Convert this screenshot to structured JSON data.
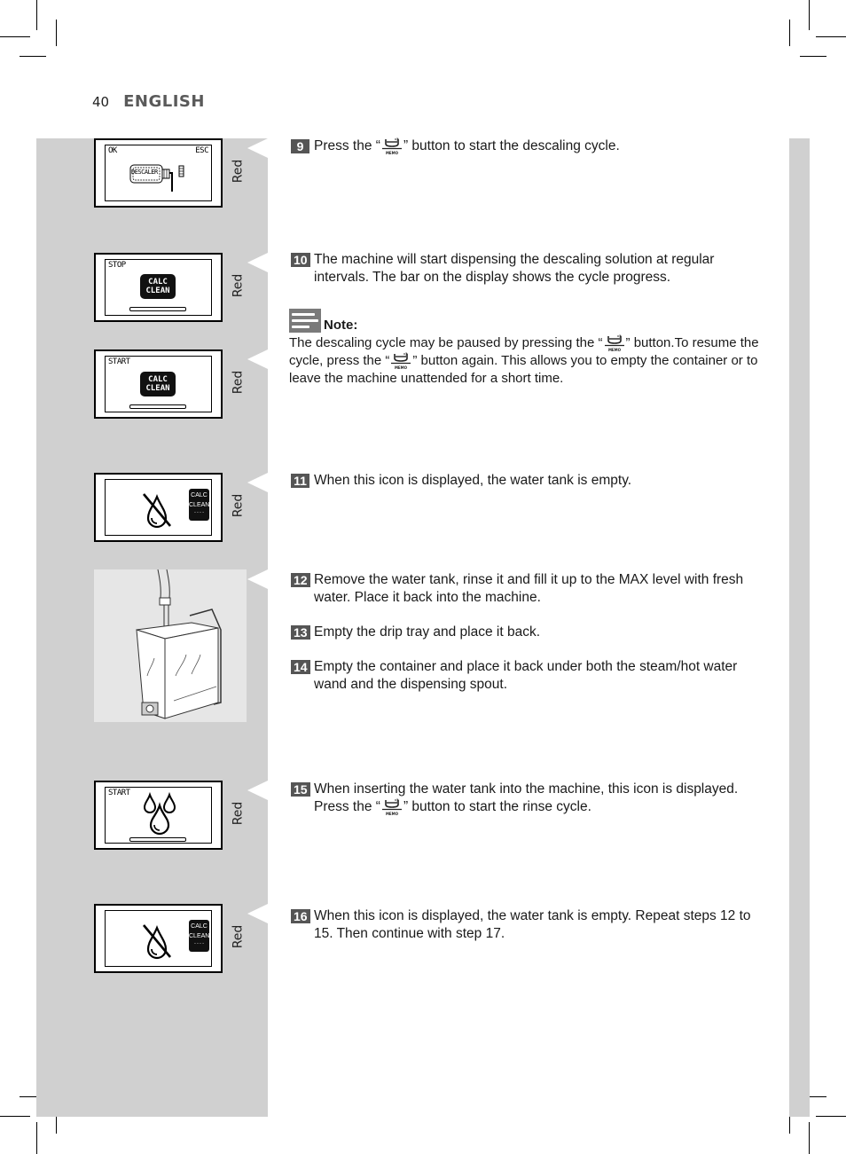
{
  "header": {
    "page_number": "40",
    "language": "ENGLISH"
  },
  "screens": [
    {
      "id": "descaler",
      "label": "Red",
      "texts": {
        "left": "OK",
        "right": "ESC",
        "bottle": "DESCALER"
      }
    },
    {
      "id": "stop",
      "label": "Red",
      "texts": {
        "left": "STOP",
        "badge_line1": "CALC",
        "badge_line2": "CLEAN"
      }
    },
    {
      "id": "start",
      "label": "Red",
      "texts": {
        "left": "START",
        "badge_line1": "CALC",
        "badge_line2": "CLEAN"
      }
    },
    {
      "id": "empty-tank-1",
      "label": "Red",
      "texts": {
        "side_line1": "CALC",
        "side_line2": "CLEAN",
        "side_line3": "- - - -"
      }
    },
    {
      "id": "rinse-start",
      "label": "Red",
      "texts": {
        "left": "START"
      }
    },
    {
      "id": "empty-tank-2",
      "label": "Red",
      "texts": {
        "side_line1": "CALC",
        "side_line2": "CLEAN",
        "side_line3": "- - - -"
      }
    }
  ],
  "icons": {
    "memo_button": "memo-coffee-button-icon",
    "memo_caption": "MEMO",
    "note": "note-icon"
  },
  "steps": [
    {
      "number": "9",
      "before": "Press the “",
      "after": "” button to start the descaling cycle."
    },
    {
      "number": "10",
      "text": "The machine will start dispensing the descaling solution at regular intervals. The bar on the display shows the cycle progress."
    },
    {
      "number": "11",
      "text": "When this icon is displayed, the water tank is empty."
    },
    {
      "number": "12",
      "text": "Remove the water tank, rinse it and fill it up to the MAX level with fresh water. Place it back into the machine."
    },
    {
      "number": "13",
      "text": "Empty the drip tray and place it back."
    },
    {
      "number": "14",
      "text": "Empty the container and place it back under both the steam/hot water wand and the dispensing spout."
    },
    {
      "number": "15",
      "before": "When inserting the water tank into the machine, this icon is displayed. Press the “",
      "after": "” button to start the rinse cycle."
    },
    {
      "number": "16",
      "text": "When this icon is displayed, the water tank is empty. Repeat steps 12 to 15. Then continue with step 17."
    }
  ],
  "note": {
    "title": "Note:",
    "part1": "The descaling cycle may be paused by pressing the “",
    "part2": "” button.To resume the cycle, press the “",
    "part3": "” button again. This allows you to empty the container or to leave the machine unattended for a short time."
  }
}
